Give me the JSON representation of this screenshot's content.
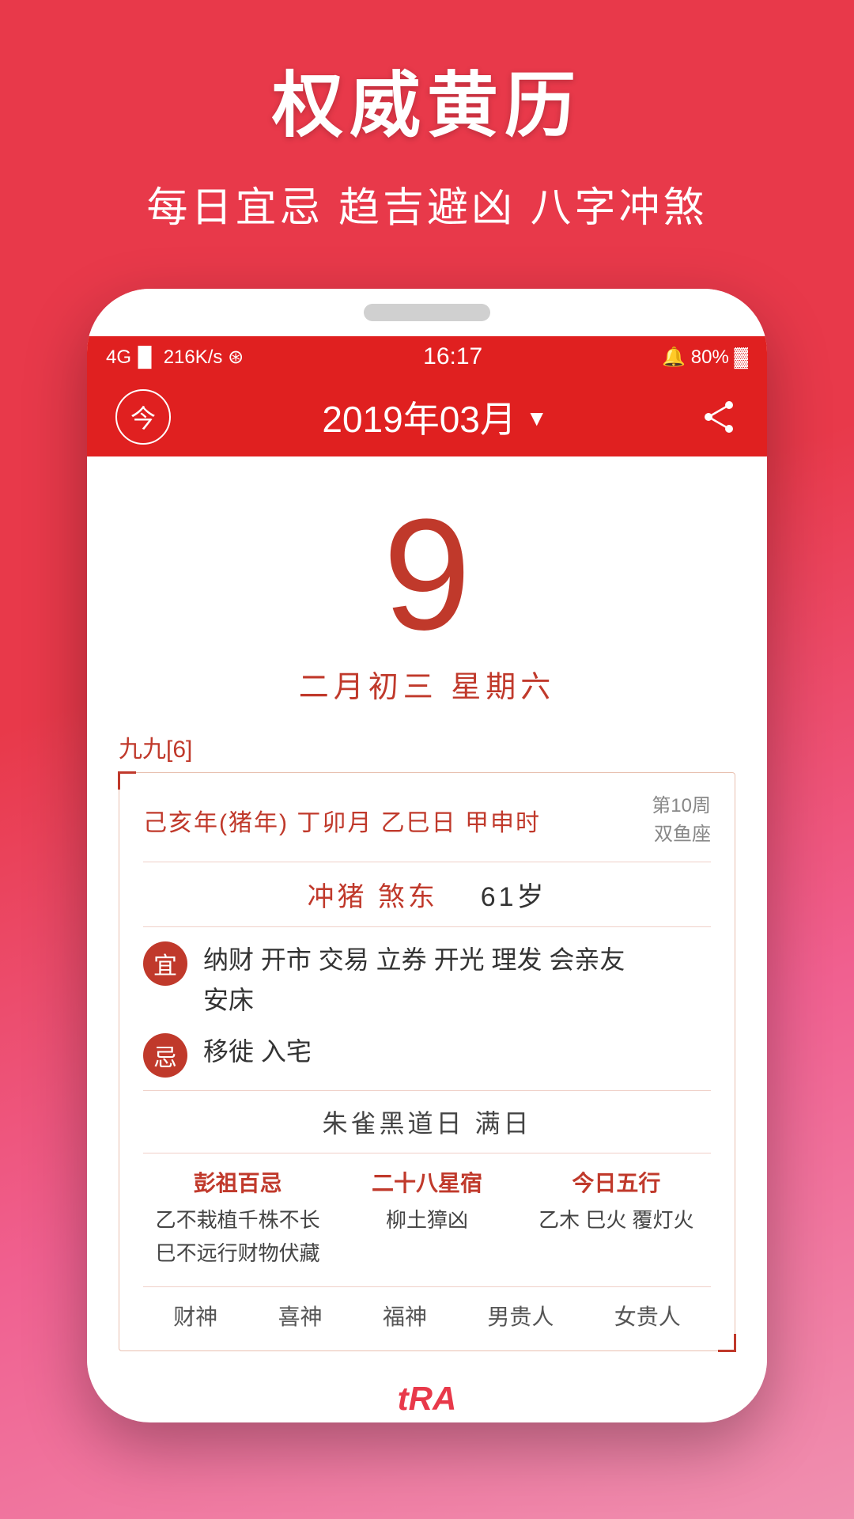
{
  "marketing": {
    "title": "权威黄历",
    "subtitle": "每日宜忌 趋吉避凶 八字冲煞"
  },
  "status_bar": {
    "signal": "4G ▌▌ 216K/s ✦",
    "time": "16:17",
    "battery": "🔔 80%"
  },
  "header": {
    "today_label": "今",
    "month_title": "2019年03月",
    "dropdown_arrow": "▼"
  },
  "calendar": {
    "day_number": "9",
    "lunar_date": "二月初三  星期六",
    "nine_nine": "九九[6]",
    "ganzhi": "己亥年(猪年) 丁卯月 乙巳日 甲申时",
    "week_line1": "第10周",
    "week_line2": "双鱼座",
    "conflict_text": "冲猪  煞东",
    "conflict_age": "61岁",
    "yi_label": "宜",
    "yi_content": "纳财 开市 交易 立券 开光 理发 会亲友\n安床",
    "ji_label": "忌",
    "ji_content": "移徙 入宅",
    "special_day": "朱雀黑道日  满日",
    "col1_title": "彭祖百忌",
    "col1_line1": "乙不栽植千株不长",
    "col1_line2": "巳不远行财物伏藏",
    "col2_title": "二十八星宿",
    "col2_content": "柳土獐凶",
    "col3_title": "今日五行",
    "col3_content": "乙木 巳火 覆灯火",
    "five_gods": [
      "财神",
      "喜神",
      "福神",
      "男贵人",
      "女贵人"
    ]
  },
  "watermark": {
    "text": "tRA"
  }
}
